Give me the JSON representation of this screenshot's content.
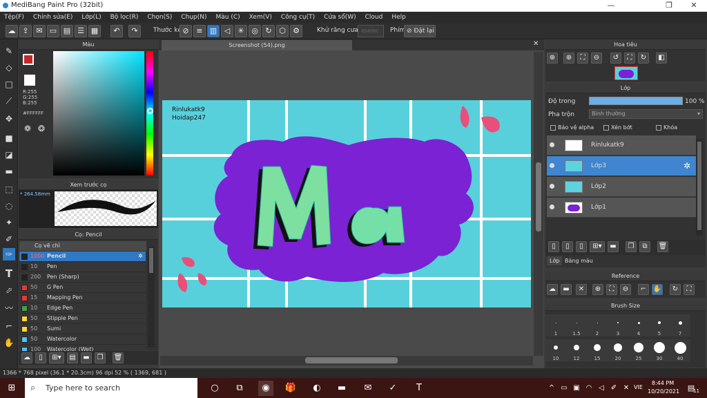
{
  "window": {
    "title": "MediBang Paint Pro (32bit)",
    "min": "—",
    "max": "❐",
    "close": "✕"
  },
  "menu": [
    "Tệp(F)",
    "Chỉnh sửa(E)",
    "Lớp(L)",
    "Bộ lọc(R)",
    "Chọn(S)",
    "Chụp(N)",
    "Màu (C)",
    "Xem(V)",
    "Công cụ(T)",
    "Cửa sổ(W)",
    "Cloud",
    "Help"
  ],
  "toolbar": {
    "ruler_label": "Thước kẻ",
    "antialias_label": "Khử răng cưa",
    "key_label": "Phím",
    "reset_label": "Đặt lại",
    "select_field": "eselec"
  },
  "color_panel": {
    "title": "Màu",
    "r": "R:255",
    "g": "G:255",
    "b": "B:255",
    "hex": "#FFFFFF"
  },
  "preview_panel": {
    "title": "Xem trước cọ",
    "size": "* 264.58mm"
  },
  "brush_panel": {
    "title": "Cọ: Pencil",
    "group": "Cọ vẽ chì",
    "items": [
      {
        "size": "1000",
        "name": "Pencil",
        "color": "#222222",
        "active": true
      },
      {
        "size": "10",
        "name": "Pen",
        "color": "#222222"
      },
      {
        "size": "200",
        "name": "Pen (Sharp)",
        "color": "#222222"
      },
      {
        "size": "50",
        "name": "G Pen",
        "color": "#e53935"
      },
      {
        "size": "15",
        "name": "Mapping Pen",
        "color": "#e53935"
      },
      {
        "size": "10",
        "name": "Edge Pen",
        "color": "#43a047"
      },
      {
        "size": "50",
        "name": "Stipple Pen",
        "color": "#fdd835"
      },
      {
        "size": "50",
        "name": "Sumi",
        "color": "#fdd835"
      },
      {
        "size": "50",
        "name": "Watercolor",
        "color": "#4fc3f7"
      },
      {
        "size": "100",
        "name": "Watercolor (Wet)",
        "color": "#4fc3f7"
      }
    ]
  },
  "canvas": {
    "tab": "Screenshot (54).png",
    "text1": "Rinlukatk9",
    "text2": "Hoidap247",
    "art_text": "Ma"
  },
  "navigator": {
    "title": "Hoa tiêu"
  },
  "layer_panel": {
    "title": "Lớp",
    "opacity_label": "Độ trong",
    "opacity_value": "100 %",
    "blend_label": "Pha trộn",
    "blend_value": "Bình thường",
    "protect_alpha": "Bảo vệ alpha",
    "clipping": "Xén bớt",
    "lock": "Khóa",
    "layers": [
      {
        "name": "Rinlukatk9",
        "active": false
      },
      {
        "name": "Lớp3",
        "active": true
      },
      {
        "name": "Lớp2",
        "active": false
      },
      {
        "name": "Lớp1",
        "active": false
      }
    ],
    "tab_layer": "Lớp",
    "tab_color": "Bảng màu"
  },
  "reference": {
    "title": "Reference"
  },
  "brush_size": {
    "title": "Brush Size",
    "sizes": [
      "1",
      "1.5",
      "2",
      "3",
      "4",
      "5",
      "7",
      "10",
      "12",
      "15",
      "20",
      "25",
      "30",
      "40"
    ]
  },
  "status": "1366 * 768 pixel   (36.1 * 20.3cm)   96 dpi   52 %   ( 1369, 681 )",
  "taskbar": {
    "search": "Type here to search",
    "time": "8:44 PM",
    "date": "10/20/2021",
    "lang": "VIE",
    "badge": "11"
  }
}
